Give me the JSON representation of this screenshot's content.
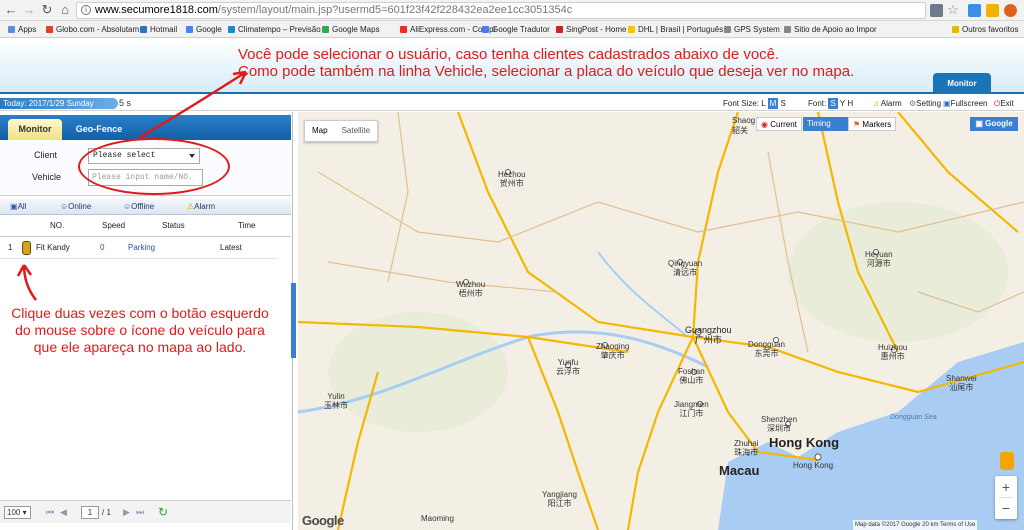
{
  "browser": {
    "url_domain": "www.secumore1818.com",
    "url_path": "/system/layout/main.jsp?usermd5=601f23f42f228432ea2ee1cc3051354c",
    "bookmarks": [
      "Apps",
      "Globo.com - Absolutam",
      "Hotmail",
      "Google",
      "Climatempo – Previsão",
      "Google Maps",
      "AliExpress.com - Compr",
      "Google Tradutor",
      "SingPost - Home",
      "DHL | Brasil | Português",
      "GPS System",
      "Sitio de Apoio ao Impor",
      "Outros favoritos"
    ]
  },
  "annotations": {
    "top_line1": "Você pode selecionar o usuário, caso tenha clientes cadastrados abaixo de você.",
    "top_line2": "Como pode também na linha Vehicle, selecionar a placa do veículo que deseja ver no mapa.",
    "left_note": "Clique duas vezes com o botão esquerdo do mouse sobre o ícone do veículo para que ele apareça no mapa ao lado."
  },
  "header": {
    "monitor_tab": "Monitor"
  },
  "infobar": {
    "today": "Today: 2017/1/29 Sunday",
    "seconds": "5 s",
    "font_size_label": "Font Size:",
    "font_size_options": [
      "L",
      "M",
      "S"
    ],
    "font_label": "Font:",
    "font_options": [
      "S",
      "Y",
      "H"
    ],
    "alarm": "Alarm",
    "setting": "Setting",
    "fullscreen": "Fullscreen",
    "exit": "Exit"
  },
  "left_panel": {
    "tabs": [
      "Monitor",
      "Geo-Fence"
    ],
    "client_label": "Client",
    "client_value": "Please select",
    "vehicle_label": "Vehicle",
    "vehicle_placeholder": "Please input name/NO.",
    "filters": [
      "All",
      "Online",
      "Offline",
      "Alarm"
    ],
    "columns": [
      "NO.",
      "Speed",
      "Status",
      "Time"
    ],
    "rows": [
      {
        "index": "1",
        "name": "Fit Kandy",
        "speed": "0",
        "status": "Parking",
        "time": "Latest"
      }
    ],
    "pager": {
      "page_size": "100",
      "page": "1",
      "total": "/ 1"
    }
  },
  "map": {
    "types": [
      "Map",
      "Satellite"
    ],
    "controls": [
      "Current",
      "Timing",
      "Markers"
    ],
    "google_button": "Google",
    "logo": "Google",
    "attribution": "Map data ©2017 Google    20 km        Terms of Use",
    "labels": {
      "shaoguan": "Shaog",
      "hezhou": "Hezhou",
      "hezhou_cn": "贺州市",
      "qingyuan": "Qingyuan",
      "qingyuan_cn": "清远市",
      "heyuan": "Heyuan",
      "heyuan_cn": "河源市",
      "wuzhou": "Wuzhou",
      "wuzhou_cn": "梧州市",
      "guangzhou": "Guangzhou",
      "guangzhou_cn": "广州市",
      "zhaoqing": "Zhaoqing",
      "zhaoqing_cn": "肇庆市",
      "dongguan": "Dongguan",
      "dongguan_cn": "东莞市",
      "huizhou": "Huizhou",
      "huizhou_cn": "惠州市",
      "yunfu": "Yunfu",
      "yunfu_cn": "云浮市",
      "foshan": "Foshan",
      "foshan_cn": "佛山市",
      "jiangmen": "Jiangmen",
      "jiangmen_cn": "江门市",
      "shenzhen": "Shenzhen",
      "shenzhen_cn": "深圳市",
      "zhuhai": "Zhuhai",
      "zhuhai_cn": "珠海市",
      "hongkong": "Hong Kong",
      "hongkong_sub": "Hong Kong",
      "macau": "Macau",
      "shanwei": "Shanwei",
      "shanwei_cn": "汕尾市",
      "yulin": "Yulin",
      "yulin_cn": "玉林市",
      "yangjiang": "Yangjiang",
      "yangjiang_cn": "阳江市",
      "maoming": "Maoming",
      "dongsha": "Dongguan Sea",
      "shaoguan_cn": "韶关"
    }
  }
}
